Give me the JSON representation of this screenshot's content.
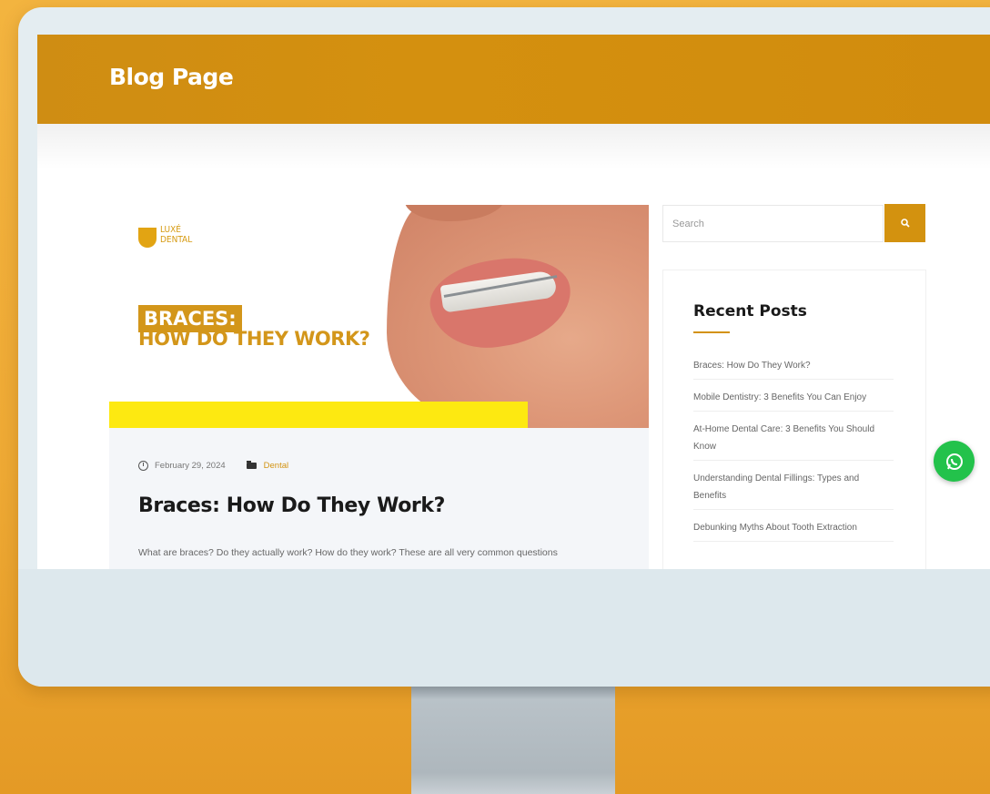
{
  "header": {
    "title": "Blog Page"
  },
  "featured_image": {
    "logo_text": [
      "LUXÉ",
      "DENTAL"
    ],
    "tag_text": "BRACES:",
    "subtitle": "HOW DO THEY WORK?"
  },
  "post": {
    "date": "February 29, 2024",
    "category": "Dental",
    "title": "Braces: How Do They Work?",
    "excerpt": "What are braces? Do they actually work? How do they work? These are all very common questions"
  },
  "sidebar": {
    "search_placeholder": "Search",
    "recent_title": "Recent Posts",
    "recent_posts": [
      "Braces: How Do They Work?",
      "Mobile Dentistry: 3 Benefits You Can Enjoy",
      "At-Home Dental Care: 3 Benefits You Should Know",
      "Understanding Dental Fillings: Types and Benefits",
      "Debunking Myths About Tooth Extraction"
    ]
  },
  "colors": {
    "accent": "#d3920f",
    "background": "#f1b03a",
    "whatsapp": "#23c24b"
  },
  "icons": {
    "search": "search-icon",
    "date": "clock-icon",
    "category": "folder-icon",
    "chat": "whatsapp-icon"
  }
}
